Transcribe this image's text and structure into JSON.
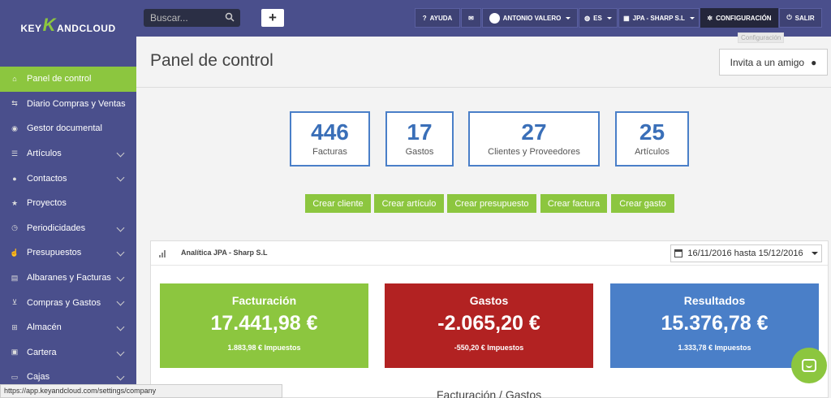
{
  "brand": {
    "pre": "KEY",
    "k": "K",
    "post": "ANDCLOUD"
  },
  "search": {
    "placeholder": "Buscar..."
  },
  "toolbar": {
    "add_label": "+"
  },
  "topnav": {
    "help": "AYUDA",
    "user": "ANTONIO VALERO",
    "lang": "ES",
    "company": "JPA - SHARP S.L",
    "settings": "CONFIGURACIÓN",
    "logout": "SALIR",
    "tooltip": "Configuración"
  },
  "sidebar": {
    "items": [
      {
        "label": "Panel de control",
        "icon": "home-icon"
      },
      {
        "label": "Diario Compras y Ventas",
        "icon": "exchange-icon"
      },
      {
        "label": "Gestor documental",
        "icon": "documents-icon"
      },
      {
        "label": "Artículos",
        "icon": "list-icon"
      },
      {
        "label": "Contactos",
        "icon": "user-icon"
      },
      {
        "label": "Proyectos",
        "icon": "star-icon"
      },
      {
        "label": "Periodicidades",
        "icon": "clock-icon"
      },
      {
        "label": "Presupuestos",
        "icon": "thumbs-up-icon"
      },
      {
        "label": "Albaranes y Facturas",
        "icon": "file-icon"
      },
      {
        "label": "Compras y Gastos",
        "icon": "cart-icon"
      },
      {
        "label": "Almacén",
        "icon": "grid-icon"
      },
      {
        "label": "Cartera",
        "icon": "wallet-icon"
      },
      {
        "label": "Cajas",
        "icon": "cash-icon"
      }
    ]
  },
  "main": {
    "title": "Panel de control",
    "invite_label": "Invita a un amigo",
    "stats": [
      {
        "value": "446",
        "label": "Facturas"
      },
      {
        "value": "17",
        "label": "Gastos"
      },
      {
        "value": "27",
        "label": "Clientes y Proveedores"
      },
      {
        "value": "25",
        "label": "Artículos"
      }
    ],
    "actions": [
      "Crear cliente",
      "Crear artículo",
      "Crear presupuesto",
      "Crear factura",
      "Crear gasto"
    ],
    "analytics": {
      "title": "Analítica JPA - Sharp S.L",
      "date_range": "16/11/2016 hasta 15/12/2016",
      "kpis": [
        {
          "title": "Facturación",
          "value": "17.441,98 €",
          "sub": "1.883,98 € Impuestos",
          "color": "#8cc63f"
        },
        {
          "title": "Gastos",
          "value": "-2.065,20 €",
          "sub": "-550,20 € Impuestos",
          "color": "#b22222"
        },
        {
          "title": "Resultados",
          "value": "15.376,78 €",
          "sub": "1.333,78 € Impuestos",
          "color": "#4a7fc8"
        }
      ],
      "chart_title": "Facturación / Gastos"
    }
  },
  "status_url": "https://app.keyandcloud.com/settings/company"
}
